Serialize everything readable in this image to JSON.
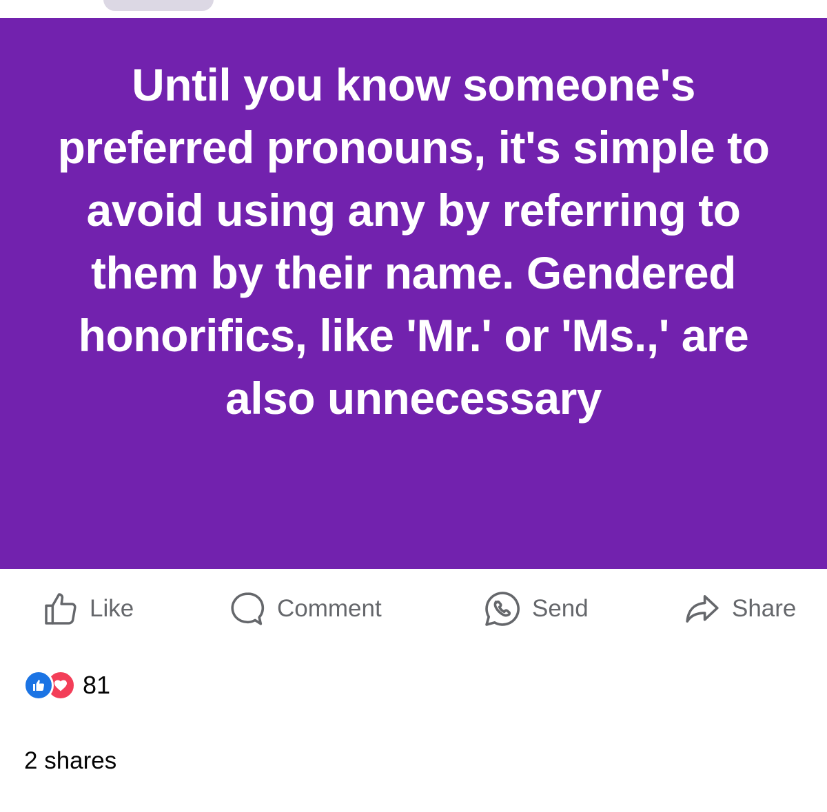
{
  "post": {
    "text": "Until you know someone's preferred pronouns, it's simple to avoid using any by referring to them by their name. Gendered honorifics, like 'Mr.' or 'Ms.,' are also unnecessary",
    "background_color": "#7222ae",
    "text_color": "#ffffff"
  },
  "actions": {
    "like": {
      "label": "Like",
      "icon": "thumbs-up-icon"
    },
    "comment": {
      "label": "Comment",
      "icon": "comment-bubble-icon"
    },
    "send": {
      "label": "Send",
      "icon": "messenger-icon"
    },
    "share": {
      "label": "Share",
      "icon": "share-arrow-icon"
    }
  },
  "reactions": {
    "icons": [
      "like-reaction-icon",
      "love-reaction-icon"
    ],
    "count": "81"
  },
  "shares": {
    "text": "2 shares"
  }
}
